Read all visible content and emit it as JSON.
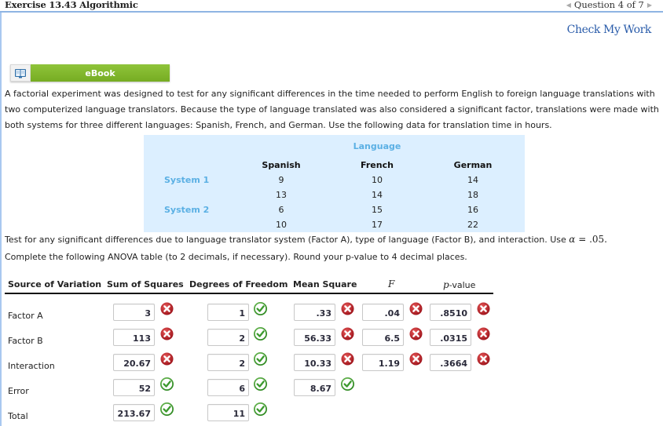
{
  "header": {
    "exercise_title": "Exercise 13.43 Algorithmic",
    "question_nav": "Question 4 of 7",
    "prev_arrow": "◀",
    "next_arrow": "▶"
  },
  "check_my_work": "Check My Work",
  "ebook": {
    "label": "eBook",
    "icon": "open-book-icon"
  },
  "problem_text": "A factorial experiment was designed to test for any significant differences in the time needed to perform English to foreign language translations with two computerized language translators. Because the type of language translated was also considered a significant factor, translations were made with both systems for three different languages: Spanish, French, and German. Use the following data for translation time in hours.",
  "data_table": {
    "group_header": "Language",
    "columns": [
      "Spanish",
      "French",
      "German"
    ],
    "rows": [
      {
        "label": "System 1",
        "values": [
          "9",
          "10",
          "14"
        ]
      },
      {
        "label": "",
        "values": [
          "13",
          "14",
          "18"
        ]
      },
      {
        "label": "System 2",
        "values": [
          "6",
          "15",
          "16"
        ]
      },
      {
        "label": "",
        "values": [
          "10",
          "17",
          "22"
        ]
      }
    ]
  },
  "instruction_1": {
    "text": "Test for any significant differences due to language translator system (Factor A), type of language (Factor B), and interaction. Use ",
    "alpha_symbol": "α",
    "equals": " = ",
    "alpha_value": ".05",
    "end": "."
  },
  "instruction_2": "Complete the following ANOVA table (to 2 decimals, if necessary). Round your p-value to 4 decimal places.",
  "anova": {
    "headers": {
      "source": "Source of Variation",
      "ss": "Sum of Squares",
      "df": "Degrees of Freedom",
      "ms": "Mean Square",
      "f": "F",
      "p_prefix": "p",
      "p_suffix": "-value"
    },
    "rows": [
      {
        "source": "Factor A",
        "ss": "3",
        "ss_ok": false,
        "df": "1",
        "df_ok": true,
        "ms": ".33",
        "ms_ok": false,
        "f": ".04",
        "f_ok": false,
        "p": ".8510",
        "p_ok": false
      },
      {
        "source": "Factor B",
        "ss": "113",
        "ss_ok": false,
        "df": "2",
        "df_ok": true,
        "ms": "56.33",
        "ms_ok": false,
        "f": "6.5",
        "f_ok": false,
        "p": ".0315",
        "p_ok": false
      },
      {
        "source": "Interaction",
        "ss": "20.67",
        "ss_ok": false,
        "df": "2",
        "df_ok": true,
        "ms": "10.33",
        "ms_ok": false,
        "f": "1.19",
        "f_ok": false,
        "p": ".3664",
        "p_ok": false
      },
      {
        "source": "Error",
        "ss": "52",
        "ss_ok": true,
        "df": "6",
        "df_ok": true,
        "ms": "8.67",
        "ms_ok": true
      },
      {
        "source": "Total",
        "ss": "213.67",
        "ss_ok": true,
        "df": "11",
        "df_ok": true
      }
    ]
  },
  "colors": {
    "correct": "#3c9a2e",
    "incorrect": "#c0202a",
    "ebook_green": "#80b82c",
    "table_bg": "#dcefff",
    "accent_blue": "#5bb0e4",
    "link": "#2a5caa"
  }
}
